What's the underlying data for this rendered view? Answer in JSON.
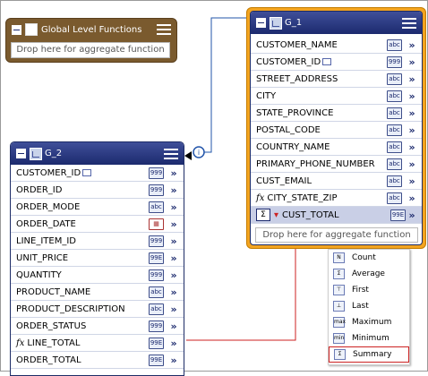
{
  "global": {
    "title": "Global Level Functions",
    "drop": "Drop here for aggregate function"
  },
  "g1": {
    "title": "G_1",
    "rows": [
      {
        "label": "CUSTOMER_NAME",
        "type": "abc",
        "key": false,
        "fx": false
      },
      {
        "label": "CUSTOMER_ID",
        "type": "999",
        "key": true,
        "fx": false
      },
      {
        "label": "STREET_ADDRESS",
        "type": "abc",
        "key": false,
        "fx": false
      },
      {
        "label": "CITY",
        "type": "abc",
        "key": false,
        "fx": false
      },
      {
        "label": "STATE_PROVINCE",
        "type": "abc",
        "key": false,
        "fx": false
      },
      {
        "label": "POSTAL_CODE",
        "type": "abc",
        "key": false,
        "fx": false
      },
      {
        "label": "COUNTRY_NAME",
        "type": "abc",
        "key": false,
        "fx": false
      },
      {
        "label": "PRIMARY_PHONE_NUMBER",
        "type": "abc",
        "key": false,
        "fx": false
      },
      {
        "label": "CUST_EMAIL",
        "type": "abc",
        "key": false,
        "fx": false
      },
      {
        "label": "CITY_STATE_ZIP",
        "type": "abc",
        "key": false,
        "fx": true
      }
    ],
    "agg_row": {
      "label": "CUST_TOTAL",
      "type": "99E"
    },
    "drop": "Drop here for aggregate function"
  },
  "g2": {
    "title": "G_2",
    "rows": [
      {
        "label": "CUSTOMER_ID",
        "type": "999",
        "key": true,
        "fx": false
      },
      {
        "label": "ORDER_ID",
        "type": "999",
        "key": false,
        "fx": false
      },
      {
        "label": "ORDER_MODE",
        "type": "abc",
        "key": false,
        "fx": false
      },
      {
        "label": "ORDER_DATE",
        "type": "cal",
        "key": false,
        "fx": false
      },
      {
        "label": "LINE_ITEM_ID",
        "type": "999",
        "key": false,
        "fx": false
      },
      {
        "label": "UNIT_PRICE",
        "type": "99E",
        "key": false,
        "fx": false
      },
      {
        "label": "QUANTITY",
        "type": "999",
        "key": false,
        "fx": false
      },
      {
        "label": "PRODUCT_NAME",
        "type": "abc",
        "key": false,
        "fx": false
      },
      {
        "label": "PRODUCT_DESCRIPTION",
        "type": "abc",
        "key": false,
        "fx": false
      },
      {
        "label": "ORDER_STATUS",
        "type": "999",
        "key": false,
        "fx": false
      },
      {
        "label": "LINE_TOTAL",
        "type": "99E",
        "key": false,
        "fx": true
      },
      {
        "label": "ORDER_TOTAL",
        "type": "99E",
        "key": false,
        "fx": false
      }
    ]
  },
  "aggregate_menu": [
    {
      "label": "Count",
      "icon": "N"
    },
    {
      "label": "Average",
      "icon": "Σ"
    },
    {
      "label": "First",
      "icon": "⊤"
    },
    {
      "label": "Last",
      "icon": "⊥"
    },
    {
      "label": "Maximum",
      "icon": "max"
    },
    {
      "label": "Minimum",
      "icon": "min"
    },
    {
      "label": "Summary",
      "icon": "Σ",
      "selected": true
    }
  ],
  "link_badge": "i",
  "colors": {
    "header": "#1c2a6e",
    "g1_border": "#f3a41f",
    "global_bg": "#7a5a2e",
    "link": "#2255aa",
    "highlight": "#cc2222"
  }
}
